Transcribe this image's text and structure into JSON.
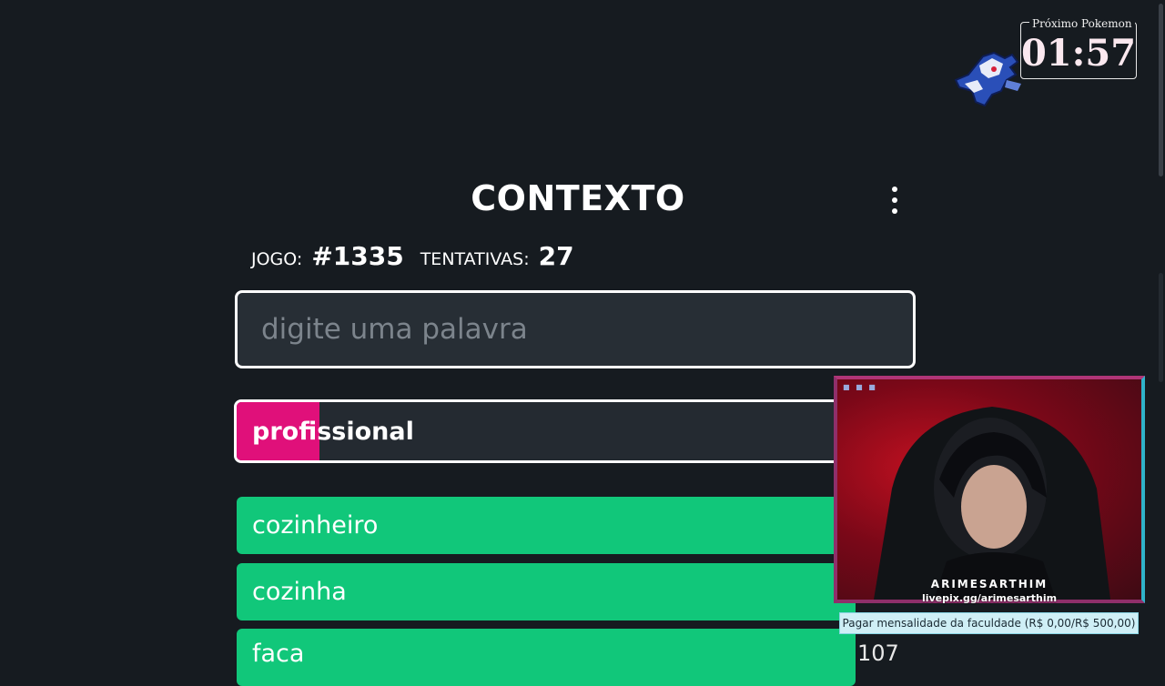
{
  "header": {
    "title": "CONTEXTO",
    "menu_icon": "vertical-ellipsis-icon"
  },
  "game_info": {
    "game_label": "JOGO:",
    "game_number": "#1335",
    "attempts_label": "TENTATIVAS:",
    "attempts_count": "27"
  },
  "input": {
    "placeholder": "digite uma palavra",
    "value": ""
  },
  "current_guess": {
    "word": "profissional",
    "color": "#e0107a",
    "border_color": "#ffffff"
  },
  "guesses": [
    {
      "word": "cozinheiro",
      "color": "#11c77a"
    },
    {
      "word": "cozinha",
      "color": "#11c77a"
    },
    {
      "word": "faca",
      "color": "#11c77a"
    }
  ],
  "partial_rank": "107",
  "overlay": {
    "next_pokemon_label": "Próximo Pokemon",
    "countdown": "01:57",
    "streamer_name": "ARIMESARTHIM",
    "livepix_url": "livepix.gg/arimesarthim",
    "goal_text": "Pagar mensalidade da faculdade (R$ 0,00/R$ 500,00)"
  },
  "colors": {
    "background": "#161b20",
    "input_bg": "#272e35",
    "accent_pink": "#e0107a",
    "accent_green": "#11c77a"
  }
}
